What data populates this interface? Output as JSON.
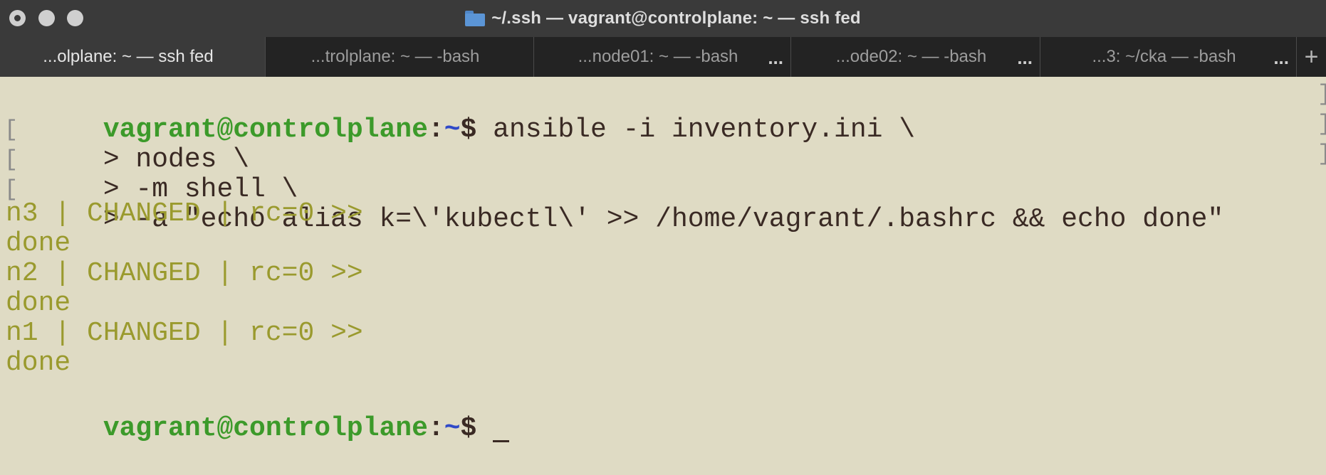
{
  "window": {
    "title": "~/.ssh — vagrant@controlplane: ~ — ssh fed"
  },
  "tabs": [
    {
      "label": "...olplane: ~ — ssh fed",
      "active": true,
      "more": ""
    },
    {
      "label": "...trolplane: ~ — -bash",
      "active": false,
      "more": ""
    },
    {
      "label": "...node01: ~ — -bash",
      "active": false,
      "more": "..."
    },
    {
      "label": "...ode02: ~ — -bash",
      "active": false,
      "more": "..."
    },
    {
      "label": "...3: ~/cka — -bash",
      "active": false,
      "more": "..."
    }
  ],
  "new_tab_label": "+",
  "terminal": {
    "prompt": {
      "user_host": "vagrant@controlplane",
      "colon": ":",
      "path": "~",
      "dollar": "$"
    },
    "command_line": " ansible -i inventory.ini \\",
    "continuation_lines": [
      "> nodes \\",
      "> -m shell \\",
      "> -a \"echo alias k=\\'kubectl\\' >> /home/vagrant/.bashrc && echo done\""
    ],
    "output_lines": [
      "n3 | CHANGED | rc=0 >>",
      "done",
      "n2 | CHANGED | rc=0 >>",
      "done",
      "n1 | CHANGED | rc=0 >>",
      "done"
    ],
    "bracket_left": "[",
    "bracket_right": "]"
  },
  "colors": {
    "terminal_bg": "#dfdbc4",
    "prompt_user": "#3c9a2a",
    "prompt_path": "#2f49c8",
    "output_text": "#9a9a2e",
    "command_text": "#3a2a24"
  }
}
